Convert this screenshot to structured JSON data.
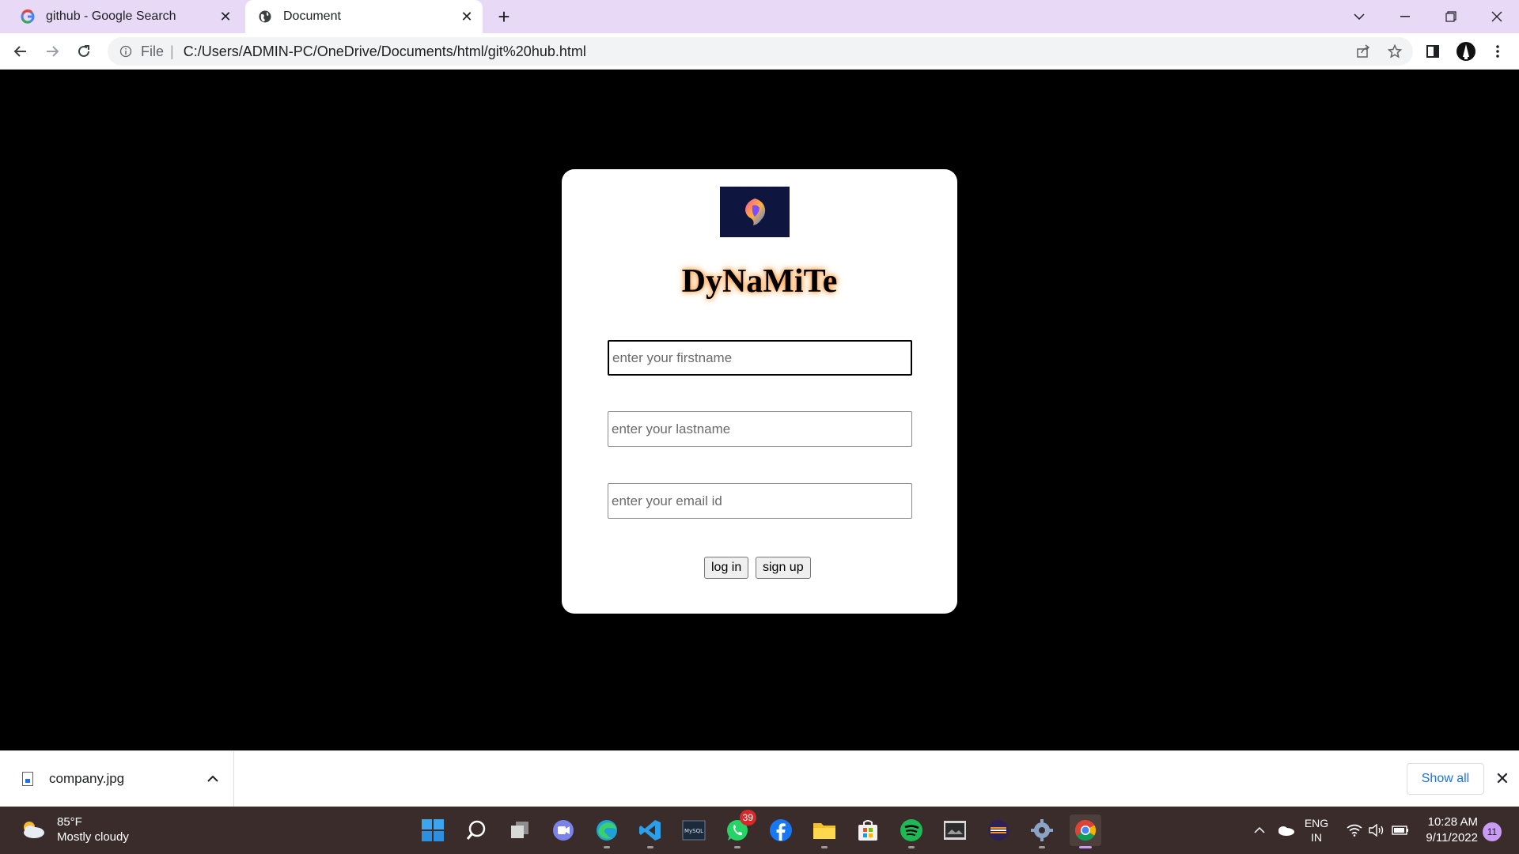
{
  "tabs": [
    {
      "title": "github - Google Search",
      "active": false
    },
    {
      "title": "Document",
      "active": true
    }
  ],
  "address_bar": {
    "scheme_label": "File",
    "url": "C:/Users/ADMIN-PC/OneDrive/Documents/html/git%20hub.html"
  },
  "page": {
    "brand": "DyNaMiTe",
    "fields": {
      "firstname_placeholder": "enter your firstname",
      "lastname_placeholder": "enter your lastname",
      "email_placeholder": "enter your email id"
    },
    "buttons": {
      "login": "log in",
      "signup": "sign up"
    },
    "colors": {
      "background": "#000000",
      "card": "#ffffff",
      "brand_glow": "#ff8c2a",
      "logo_bg": "#0e1640"
    }
  },
  "download_shelf": {
    "file_name": "company.jpg",
    "show_all_label": "Show all"
  },
  "taskbar": {
    "weather": {
      "temperature": "85°F",
      "condition": "Mostly cloudy"
    },
    "apps": [
      "start",
      "search",
      "task-view",
      "teams-chat",
      "edge",
      "vscode",
      "mysql-workbench",
      "whatsapp",
      "facebook",
      "file-explorer",
      "microsoft-store",
      "spotify",
      "photo-app",
      "eclipse",
      "settings",
      "chrome"
    ],
    "whatsapp_badge": "39",
    "language": {
      "line1": "ENG",
      "line2": "IN"
    },
    "clock": {
      "time": "10:28 AM",
      "date": "9/11/2022"
    },
    "notification_count": "11"
  }
}
